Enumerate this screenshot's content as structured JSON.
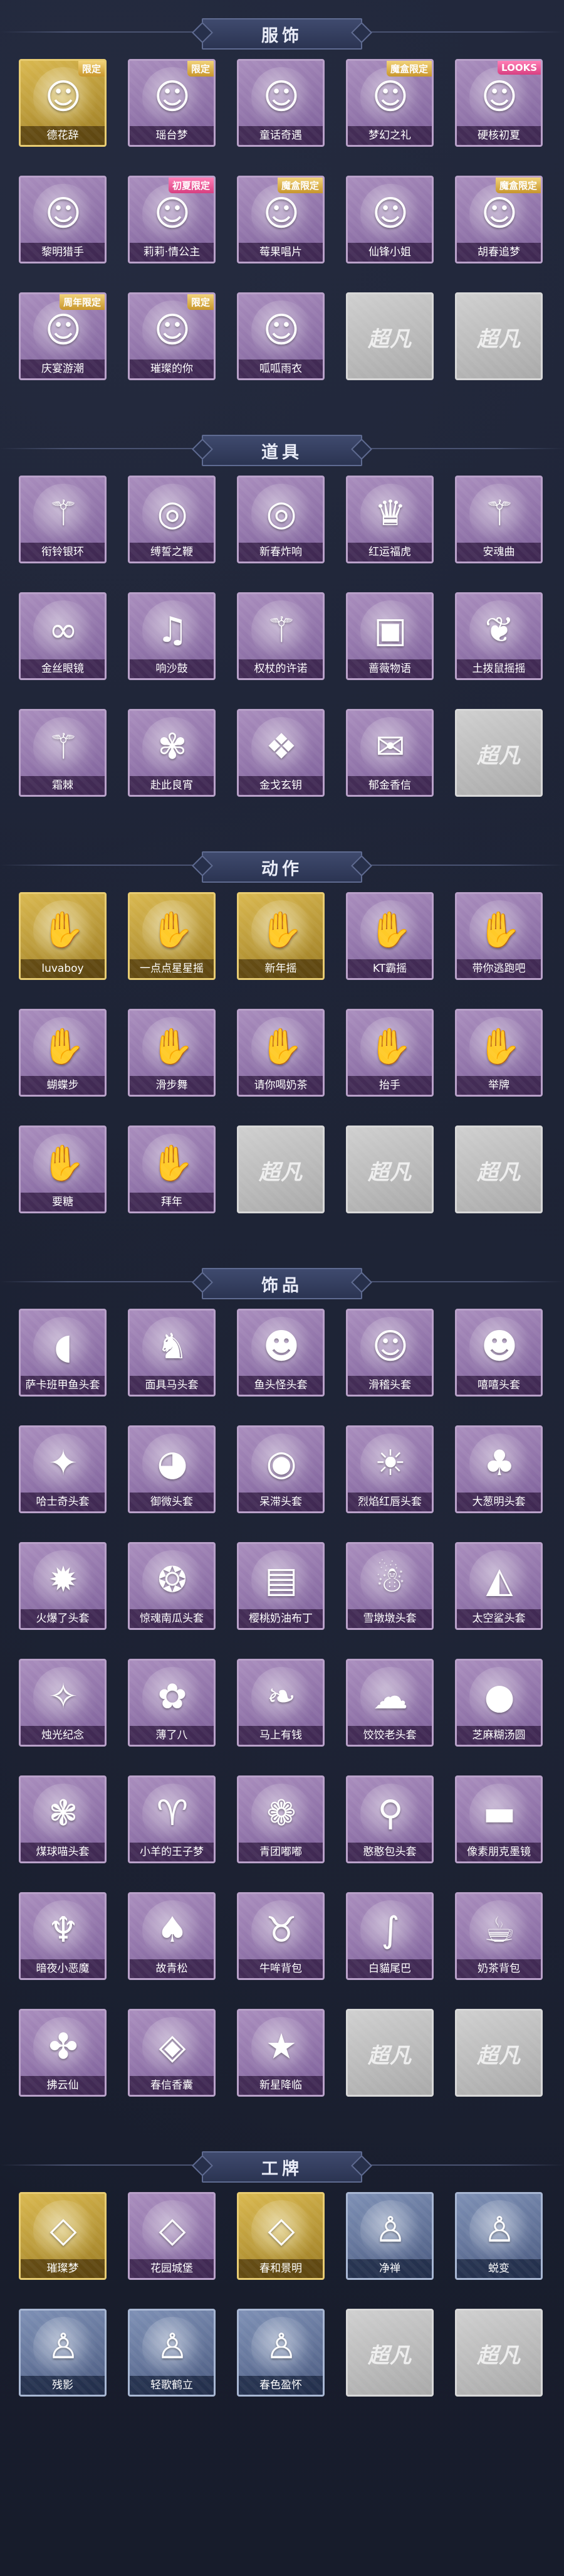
{
  "watermark": "超凡",
  "sections": [
    {
      "title": "服饰",
      "items": [
        {
          "label": "德花辞",
          "icon": "person",
          "badge": "限定",
          "style": "gold"
        },
        {
          "label": "瑶台梦",
          "icon": "person",
          "badge": "限定",
          "style": "purple"
        },
        {
          "label": "童话奇遇",
          "icon": "person",
          "badge": "",
          "style": "purple"
        },
        {
          "label": "梦幻之礼",
          "icon": "person",
          "badge": "魔盒限定",
          "style": "purple"
        },
        {
          "label": "硬核初夏",
          "icon": "person",
          "badge": "LOOKS",
          "style": "purple",
          "badgeStyle": "pink"
        },
        {
          "label": "黎明猎手",
          "icon": "person",
          "badge": "",
          "style": "purple"
        },
        {
          "label": "莉莉·情公主",
          "icon": "person",
          "badge": "初夏限定",
          "style": "purple",
          "badgeStyle": "pink"
        },
        {
          "label": "莓果唱片",
          "icon": "person",
          "badge": "魔盒限定",
          "style": "purple"
        },
        {
          "label": "仙锋小姐",
          "icon": "person",
          "badge": "",
          "style": "purple"
        },
        {
          "label": "胡春追梦",
          "icon": "person",
          "badge": "魔盒限定",
          "style": "purple"
        },
        {
          "label": "庆宴游潮",
          "icon": "person",
          "badge": "周年限定",
          "style": "purple"
        },
        {
          "label": "璀璨的你",
          "icon": "person",
          "badge": "限定",
          "style": "purple"
        },
        {
          "label": "呱呱雨衣",
          "icon": "person",
          "badge": "",
          "style": "purple"
        },
        {
          "label": "",
          "icon": "",
          "badge": "",
          "style": "empty"
        },
        {
          "label": "",
          "icon": "",
          "badge": "",
          "style": "empty"
        }
      ]
    },
    {
      "title": "道具",
      "items": [
        {
          "label": "衔铃银环",
          "icon": "staff",
          "badge": "",
          "style": "purple"
        },
        {
          "label": "缚誓之鞭",
          "icon": "ring",
          "badge": "",
          "style": "purple"
        },
        {
          "label": "新春炸响",
          "icon": "ring",
          "badge": "",
          "style": "purple"
        },
        {
          "label": "红运福虎",
          "icon": "tiger",
          "badge": "",
          "style": "purple"
        },
        {
          "label": "安魂曲",
          "icon": "staff",
          "badge": "",
          "style": "purple"
        },
        {
          "label": "金丝眼镜",
          "icon": "glasses",
          "badge": "",
          "style": "purple"
        },
        {
          "label": "响沙鼓",
          "icon": "drum",
          "badge": "",
          "style": "purple"
        },
        {
          "label": "权杖的许诺",
          "icon": "staff",
          "badge": "",
          "style": "purple"
        },
        {
          "label": "蔷薇物语",
          "icon": "box",
          "badge": "",
          "style": "purple"
        },
        {
          "label": "土拨鼠摇摇",
          "icon": "plush",
          "badge": "",
          "style": "purple"
        },
        {
          "label": "霜棘",
          "icon": "staff",
          "badge": "",
          "style": "purple"
        },
        {
          "label": "赴此良宵",
          "icon": "fan",
          "badge": "",
          "style": "purple"
        },
        {
          "label": "金戈玄钥",
          "icon": "lantern",
          "badge": "",
          "style": "purple"
        },
        {
          "label": "郁金香信",
          "icon": "letter",
          "badge": "",
          "style": "purple"
        },
        {
          "label": "",
          "icon": "",
          "badge": "",
          "style": "empty"
        }
      ]
    },
    {
      "title": "动作",
      "items": [
        {
          "label": "luvaboy",
          "icon": "pose",
          "badge": "",
          "style": "gold"
        },
        {
          "label": "一点点星星摇",
          "icon": "pose",
          "badge": "",
          "style": "gold"
        },
        {
          "label": "新年摇",
          "icon": "pose",
          "badge": "",
          "style": "gold"
        },
        {
          "label": "KT霸摇",
          "icon": "pose",
          "badge": "",
          "style": "purple"
        },
        {
          "label": "带你逃跑吧",
          "icon": "pose",
          "badge": "",
          "style": "purple"
        },
        {
          "label": "蝴蝶步",
          "icon": "pose",
          "badge": "",
          "style": "purple"
        },
        {
          "label": "滑步舞",
          "icon": "pose",
          "badge": "",
          "style": "purple"
        },
        {
          "label": "请你喝奶茶",
          "icon": "pose",
          "badge": "",
          "style": "purple"
        },
        {
          "label": "抬手",
          "icon": "pose",
          "badge": "",
          "style": "purple"
        },
        {
          "label": "举牌",
          "icon": "pose",
          "badge": "",
          "style": "purple"
        },
        {
          "label": "要糖",
          "icon": "pose",
          "badge": "",
          "style": "purple"
        },
        {
          "label": "拜年",
          "icon": "pose",
          "badge": "",
          "style": "purple"
        },
        {
          "label": "",
          "icon": "",
          "badge": "",
          "style": "empty"
        },
        {
          "label": "",
          "icon": "",
          "badge": "",
          "style": "empty"
        },
        {
          "label": "",
          "icon": "",
          "badge": "",
          "style": "empty"
        }
      ]
    },
    {
      "title": "饰品",
      "items": [
        {
          "label": "萨卡班甲鱼头套",
          "icon": "fish",
          "badge": "",
          "style": "purple"
        },
        {
          "label": "面具马头套",
          "icon": "horse",
          "badge": "",
          "style": "purple"
        },
        {
          "label": "鱼头怪头套",
          "icon": "frog",
          "badge": "",
          "style": "purple"
        },
        {
          "label": "滑稽头套",
          "icon": "smile",
          "badge": "",
          "style": "purple"
        },
        {
          "label": "嘻嘻头套",
          "icon": "grin",
          "badge": "",
          "style": "purple"
        },
        {
          "label": "哈士奇头套",
          "icon": "dog",
          "badge": "",
          "style": "purple"
        },
        {
          "label": "御微头套",
          "icon": "shy",
          "badge": "",
          "style": "purple"
        },
        {
          "label": "呆滞头套",
          "icon": "dull",
          "badge": "",
          "style": "purple"
        },
        {
          "label": "烈焰红唇头套",
          "icon": "cool",
          "badge": "",
          "style": "purple"
        },
        {
          "label": "大葱明头套",
          "icon": "sprout",
          "badge": "",
          "style": "purple"
        },
        {
          "label": "火爆了头套",
          "icon": "fire",
          "badge": "",
          "style": "purple"
        },
        {
          "label": "惊魂南瓜头套",
          "icon": "pumpkin",
          "badge": "",
          "style": "purple"
        },
        {
          "label": "樱桃奶油布丁",
          "icon": "pudding",
          "badge": "",
          "style": "purple"
        },
        {
          "label": "雪墩墩头套",
          "icon": "snowman",
          "badge": "",
          "style": "purple"
        },
        {
          "label": "太空鲨头套",
          "icon": "shark",
          "badge": "",
          "style": "purple"
        },
        {
          "label": "烛光纪念",
          "icon": "candle",
          "badge": "",
          "style": "purple"
        },
        {
          "label": "薄了八",
          "icon": "bun",
          "badge": "",
          "style": "purple"
        },
        {
          "label": "马上有钱",
          "icon": "flamingo",
          "badge": "",
          "style": "purple"
        },
        {
          "label": "饺饺老头套",
          "icon": "cloud",
          "badge": "",
          "style": "purple"
        },
        {
          "label": "芝麻糊汤圆",
          "icon": "ball",
          "badge": "",
          "style": "purple"
        },
        {
          "label": "煤球喵头套",
          "icon": "cat",
          "badge": "",
          "style": "purple"
        },
        {
          "label": "小羊的王子梦",
          "icon": "sheep",
          "badge": "",
          "style": "purple"
        },
        {
          "label": "青团嘟嘟",
          "icon": "greenball",
          "badge": "",
          "style": "purple"
        },
        {
          "label": "憨憨包头套",
          "icon": "balloon",
          "badge": "",
          "style": "purple"
        },
        {
          "label": "像素朋克墨镜",
          "icon": "shades",
          "badge": "",
          "style": "purple"
        },
        {
          "label": "暗夜小恶魔",
          "icon": "devil",
          "badge": "",
          "style": "purple"
        },
        {
          "label": "故青松",
          "icon": "tree",
          "badge": "",
          "style": "purple"
        },
        {
          "label": "牛哞背包",
          "icon": "cow",
          "badge": "",
          "style": "purple"
        },
        {
          "label": "白貓尾巴",
          "icon": "tail",
          "badge": "",
          "style": "purple"
        },
        {
          "label": "奶茶背包",
          "icon": "tea",
          "badge": "",
          "style": "purple"
        },
        {
          "label": "拂云仙",
          "icon": "charm",
          "badge": "",
          "style": "purple"
        },
        {
          "label": "春信香囊",
          "icon": "pouch",
          "badge": "",
          "style": "purple"
        },
        {
          "label": "新星降临",
          "icon": "star",
          "badge": "",
          "style": "purple"
        },
        {
          "label": "",
          "icon": "",
          "badge": "",
          "style": "empty"
        },
        {
          "label": "",
          "icon": "",
          "badge": "",
          "style": "empty"
        }
      ]
    },
    {
      "title": "工牌",
      "items": [
        {
          "label": "璀璨梦",
          "icon": "card",
          "badge": "",
          "style": "gold"
        },
        {
          "label": "花园城堡",
          "icon": "card",
          "badge": "",
          "style": "purple"
        },
        {
          "label": "春和景明",
          "icon": "card",
          "badge": "",
          "style": "gold"
        },
        {
          "label": "净禅",
          "icon": "silhouette",
          "badge": "",
          "style": "blue"
        },
        {
          "label": "蜕变",
          "icon": "silhouette",
          "badge": "",
          "style": "blue"
        },
        {
          "label": "残影",
          "icon": "silhouette",
          "badge": "",
          "style": "blue"
        },
        {
          "label": "轻歌鹤立",
          "icon": "silhouette",
          "badge": "",
          "style": "blue"
        },
        {
          "label": "春色盈怀",
          "icon": "silhouette",
          "badge": "",
          "style": "blue"
        },
        {
          "label": "",
          "icon": "",
          "badge": "",
          "style": "empty"
        },
        {
          "label": "",
          "icon": "",
          "badge": "",
          "style": "empty"
        }
      ]
    }
  ]
}
